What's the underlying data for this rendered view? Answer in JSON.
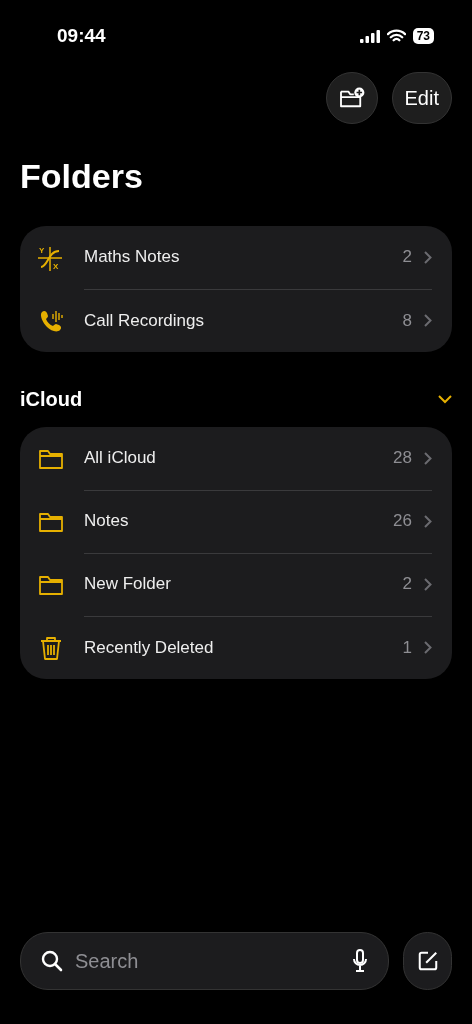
{
  "status_bar": {
    "time": "09:44",
    "battery": "73"
  },
  "toolbar": {
    "buttons": [
      {
        "kind": "new-folder"
      },
      {
        "kind": "text",
        "label": "Edit"
      }
    ]
  },
  "title": "Folders",
  "sections": [
    {
      "items": [
        {
          "kind": "graph",
          "axis_labels": [
            "Y",
            "X"
          ],
          "name": "Maths Notes",
          "count": "2"
        },
        {
          "kind": "phone",
          "name": "Call Recordings",
          "count": "8"
        }
      ]
    },
    {
      "header": "iCloud",
      "expanded": true,
      "items": [
        {
          "kind": "folder",
          "name": "All iCloud",
          "count": "28"
        },
        {
          "kind": "folder",
          "name": "Notes",
          "count": "26"
        },
        {
          "kind": "folder",
          "name": "New Folder",
          "count": "2"
        },
        {
          "kind": "trash",
          "name": "Recently Deleted",
          "count": "1"
        }
      ]
    }
  ],
  "search": {
    "placeholder": "Search"
  }
}
